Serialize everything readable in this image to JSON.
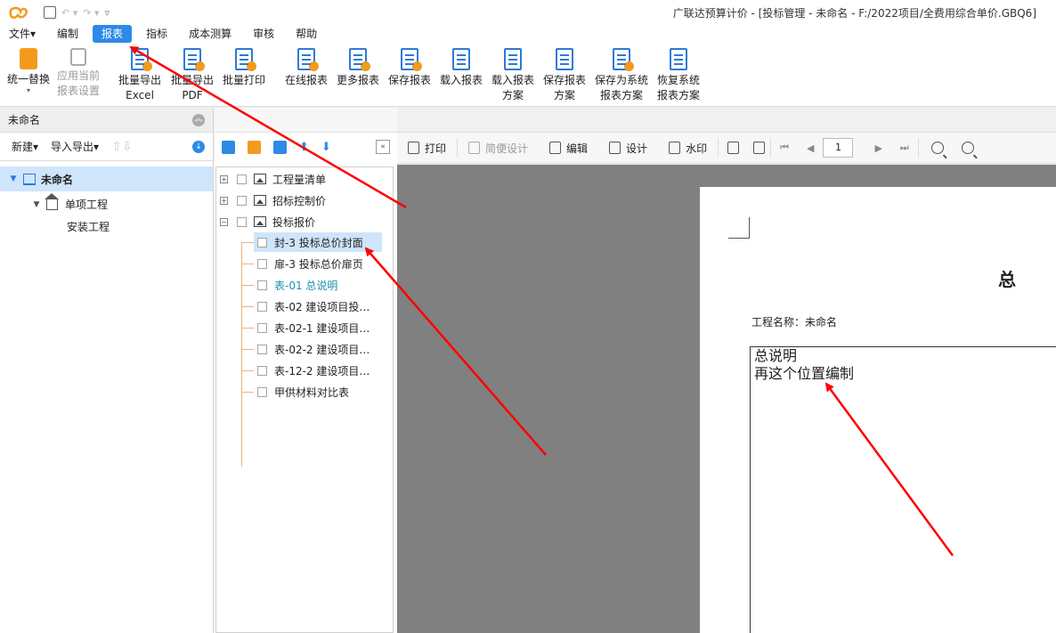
{
  "titlebar": {
    "title": "广联达预算计价 - [投标管理 - 未命名 - F:/2022项目/全费用综合单价.GBQ6]"
  },
  "menu": [
    {
      "label": "文件▾",
      "active": false
    },
    {
      "label": "编制",
      "active": false
    },
    {
      "label": "报表",
      "active": true
    },
    {
      "label": "指标",
      "active": false
    },
    {
      "label": "成本测算",
      "active": false
    },
    {
      "label": "审核",
      "active": false
    },
    {
      "label": "帮助",
      "active": false
    }
  ],
  "ribbon": {
    "unify": "统一替换",
    "apply_line1": "应用当前",
    "apply_line2": "报表设置",
    "excel_line1": "批量导出",
    "excel_line2": "Excel",
    "pdf_line1": "批量导出",
    "pdf_line2": "PDF",
    "print": "批量打印",
    "online": "在线报表",
    "more": "更多报表",
    "save": "保存报表",
    "load": "载入报表",
    "load_scheme_line1": "载入报表",
    "load_scheme_line2": "方案",
    "save_scheme_line1": "保存报表",
    "save_scheme_line2": "方案",
    "save_sys_line1": "保存为系统",
    "save_sys_line2": "报表方案",
    "restore_line1": "恢复系统",
    "restore_line2": "报表方案"
  },
  "left": {
    "header": "未命名",
    "new_label": "新建▾",
    "import_label": "导入导出▾",
    "tree": {
      "root": "未命名",
      "child": "单项工程",
      "leaf": "安装工程"
    }
  },
  "reports": {
    "nodes": [
      "工程量清单",
      "招标控制价",
      "投标报价"
    ],
    "children": [
      "封-3 投标总价封面",
      "扉-3 投标总价扉页",
      "表-01 总说明",
      "表-02 建设项目投…",
      "表-02-1 建设项目…",
      "表-02-2 建设项目…",
      "表-12-2 建设项目…",
      "甲供材料对比表"
    ]
  },
  "preview_toolbar": {
    "print": "打印",
    "simple_design": "简便设计",
    "edit": "编辑",
    "design": "设计",
    "watermark": "水印",
    "page": "1"
  },
  "document": {
    "title": "总 说",
    "project_label": "工程名称：未命名",
    "line1": "总说明",
    "line2": "再这个位置编制"
  },
  "colors": {
    "accent": "#2d8ae6",
    "arrow": "#ff0000",
    "selection": "#cfe5fb"
  }
}
